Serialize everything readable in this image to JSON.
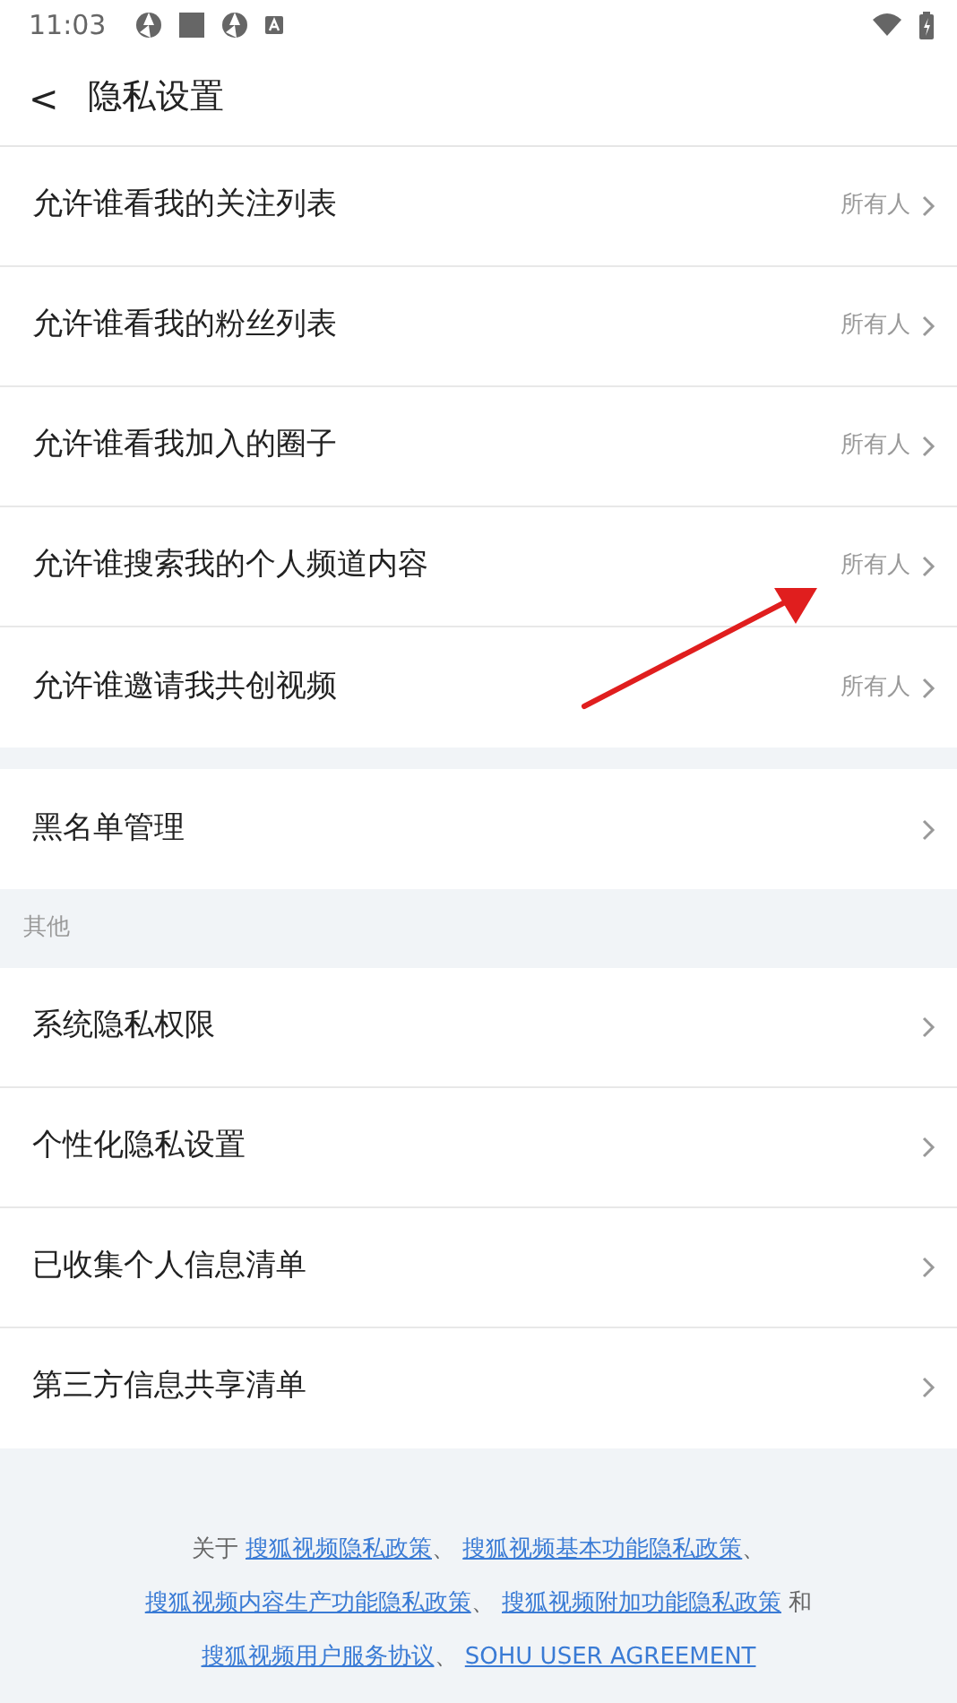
{
  "status_bar": {
    "time": "11:03"
  },
  "header": {
    "back": "<",
    "title": "隐私设置"
  },
  "sections": [
    {
      "items": [
        {
          "label": "允许谁看我的关注列表",
          "value": "所有人"
        },
        {
          "label": "允许谁看我的粉丝列表",
          "value": "所有人"
        },
        {
          "label": "允许谁看我加入的圈子",
          "value": "所有人"
        },
        {
          "label": "允许谁搜索我的个人频道内容",
          "value": "所有人"
        },
        {
          "label": "允许谁邀请我共创视频",
          "value": "所有人"
        }
      ]
    },
    {
      "items": [
        {
          "label": "黑名单管理"
        }
      ]
    },
    {
      "title": "其他",
      "items": [
        {
          "label": "系统隐私权限"
        },
        {
          "label": "个性化隐私设置"
        },
        {
          "label": "已收集个人信息清单"
        },
        {
          "label": "第三方信息共享清单"
        }
      ]
    }
  ],
  "footer": [
    {
      "kind": "text",
      "text": "关于 "
    },
    {
      "kind": "link",
      "text": "搜狐视频隐私政策"
    },
    {
      "kind": "text",
      "text": "、 "
    },
    {
      "kind": "link",
      "text": "搜狐视频基本功能隐私政策"
    },
    {
      "kind": "text",
      "text": "、 "
    },
    {
      "kind": "link",
      "text": "搜狐视频内容生产功能隐私政策"
    },
    {
      "kind": "text",
      "text": "、 "
    },
    {
      "kind": "link",
      "text": "搜狐视频附加功能隐私政策"
    },
    {
      "kind": "text",
      "text": " 和 "
    },
    {
      "kind": "link",
      "text": "搜狐视频用户服务协议"
    },
    {
      "kind": "text",
      "text": "、 "
    },
    {
      "kind": "link",
      "text": "SOHU USER AGREEMENT"
    }
  ]
}
